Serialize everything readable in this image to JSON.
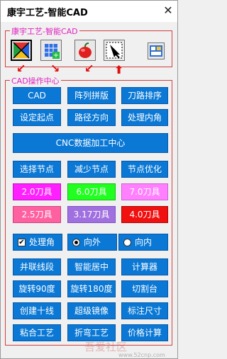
{
  "window": {
    "title": "康宇工艺-智能CAD",
    "close_glyph": "✕"
  },
  "toolbar_group": {
    "legend": "康宇工艺-智能CAD",
    "tools": [
      "x-shape-icon",
      "grid-plus-icon",
      "apple-icon",
      "arrow-box-icon",
      "panel-icon"
    ]
  },
  "ops_group": {
    "legend": "CAD操作中心",
    "row1": [
      "CAD",
      "阵列拼版",
      "刀路排序"
    ],
    "row2": [
      "设定起点",
      "路径方向",
      "处理内角"
    ],
    "cnc": "CNC数据加工中心",
    "row3": [
      "选择节点",
      "减少节点",
      "节点优化"
    ],
    "knives1": [
      {
        "label": "2.0刀具",
        "color": "#ff20ff",
        "text_color": "#ffffff"
      },
      {
        "label": "6.0刀具",
        "color": "#20ff20",
        "text_color": "#ffffff"
      },
      {
        "label": "7.0刀具",
        "color": "#ff80ff",
        "text_color": "#ffffff"
      }
    ],
    "knives2": [
      {
        "label": "2.5刀具",
        "color": "#ff60a0",
        "text_color": "#ffffff"
      },
      {
        "label": "3.17刀具",
        "color": "#a070e0",
        "text_color": "#ffffff"
      },
      {
        "label": "4.0刀具",
        "color": "#f01010",
        "text_color": "#ffffff"
      }
    ],
    "options": {
      "corner_label": "处理角",
      "corner_checked": true,
      "out_label": "向外",
      "out_selected": true,
      "in_label": "向内",
      "in_selected": false
    },
    "row4": [
      "并联线段",
      "智能居中",
      "计算器"
    ],
    "row5": [
      "旋转90度",
      "旋转180度",
      "切割台"
    ],
    "row6": [
      "创建十线",
      "超级镜像",
      "标注尺寸"
    ],
    "row7": [
      "粘合工艺",
      "折弯工艺",
      "价格计算"
    ]
  },
  "watermark": {
    "text": "吾爱社区",
    "url": "www.52cnp.com"
  }
}
